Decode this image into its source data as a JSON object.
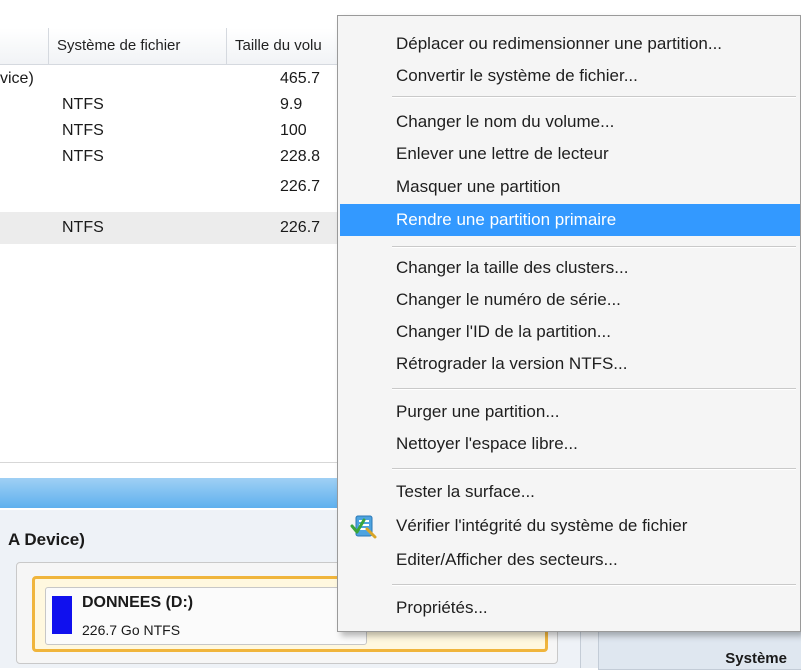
{
  "table": {
    "headers": [
      "",
      "Système de fichier",
      "Taille du volu"
    ],
    "rows": [
      {
        "c0": "vice)",
        "c1": "",
        "c2": "465.7"
      },
      {
        "c0": "",
        "c1": "NTFS",
        "c2": "9.9"
      },
      {
        "c0": "",
        "c1": "NTFS",
        "c2": "100"
      },
      {
        "c0": "",
        "c1": "NTFS",
        "c2": "228.8"
      },
      {
        "c0": "",
        "c1": "",
        "c2": "226.7"
      },
      {
        "c0": "",
        "c1": "NTFS",
        "c2": "226.7"
      }
    ]
  },
  "disk": {
    "title": "A Device)",
    "partition_name": "DONNEES (D:)",
    "partition_info": "226.7 Go NTFS",
    "partition_color": "#1010ee",
    "right_label": "Système"
  },
  "menu": {
    "items": [
      {
        "label": "Déplacer ou redimensionner une partition..."
      },
      {
        "label": "Convertir le système de fichier..."
      },
      {
        "label": "Changer le nom du volume..."
      },
      {
        "label": "Enlever une lettre de lecteur"
      },
      {
        "label": "Masquer une partition"
      },
      {
        "label": "Rendre une partition primaire",
        "highlighted": true
      },
      {
        "label": "Changer la taille des clusters..."
      },
      {
        "label": "Changer le numéro de série..."
      },
      {
        "label": "Changer l'ID de la partition..."
      },
      {
        "label": "Rétrograder la version NTFS..."
      },
      {
        "label": "Purger une partition..."
      },
      {
        "label": "Nettoyer l'espace libre..."
      },
      {
        "label": "Tester la surface..."
      },
      {
        "label": "Vérifier l'intégrité du système de fichier",
        "icon": "check-filesystem-icon"
      },
      {
        "label": "Editer/Afficher des secteurs..."
      },
      {
        "label": "Propriétés..."
      }
    ],
    "highlight_color": "#3399ff"
  }
}
